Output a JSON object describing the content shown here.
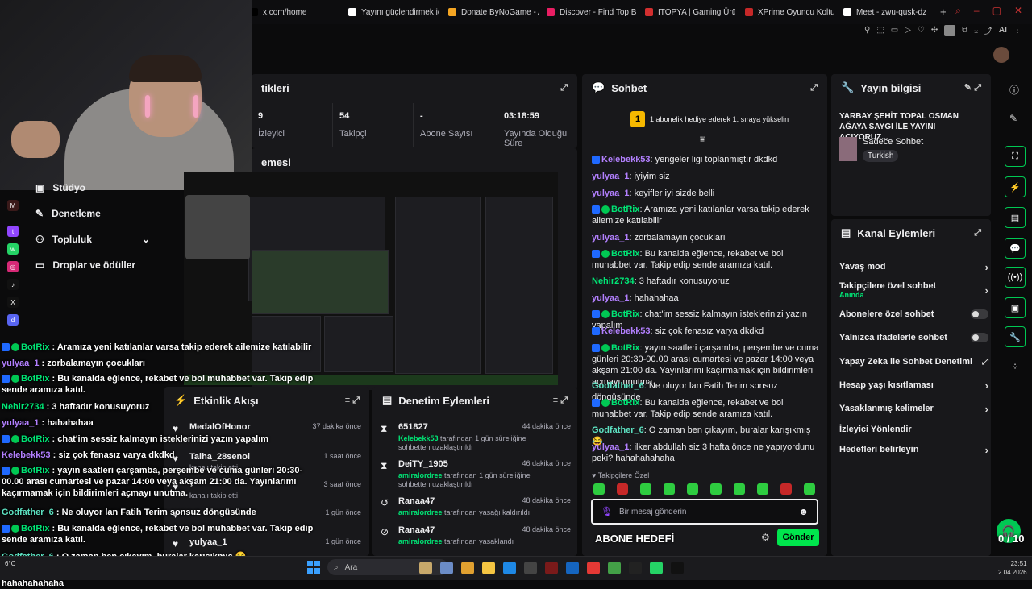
{
  "browser": {
    "tabs": [
      {
        "label": "x.com/home",
        "color": "#000000"
      },
      {
        "label": "Yayını güçlendirmek içi",
        "color": "#ffffff"
      },
      {
        "label": "Donate ByNoGame - Ak",
        "color": "#f5a623"
      },
      {
        "label": "Discover - Find Top Blo",
        "color": "#e91e63"
      },
      {
        "label": "ITOPYA | Gaming Ürünle",
        "color": "#d32f2f"
      },
      {
        "label": "XPrime Oyuncu Koltuğu",
        "color": "#c62828"
      },
      {
        "label": "Meet - zwu-qusk-dz",
        "color": "#ffffff"
      }
    ],
    "new_tab": "+",
    "toolbar_ai": "AI"
  },
  "nav": {
    "items": [
      {
        "label": "Stüdyo"
      },
      {
        "label": "Denetleme"
      },
      {
        "label": "Topluluk"
      },
      {
        "label": "Droplar ve ödüller"
      }
    ]
  },
  "stats": {
    "title": "tikleri",
    "items": [
      {
        "value": "9",
        "label": "İzleyici"
      },
      {
        "value": "54",
        "label": "Takipçi"
      },
      {
        "value": "-",
        "label": "Abone Sayısı"
      },
      {
        "value": "03:18:59",
        "label": "Yayında Olduğu Süre"
      }
    ]
  },
  "preview": {
    "title": "emesi"
  },
  "chat": {
    "title": "Sohbet",
    "banner": "1 abonelik hediye ederek 1. sıraya yükselin",
    "banner_rank": "1",
    "messages": [
      {
        "user": "Kelebekk53",
        "text": ": yengeler ligi toplanmıştır dkdkd",
        "color": "#b380ff",
        "badge": "v"
      },
      {
        "user": "yulyaa_1",
        "text": ": iyiyim siz",
        "color": "#b380ff",
        "badge": ""
      },
      {
        "user": "yulyaa_1",
        "text": ": keyifler iyi sizde belli",
        "color": "#b380ff",
        "badge": ""
      },
      {
        "user": "BotRix",
        "text": ": Aramıza yeni katılanlar varsa takip ederek ailemize katılabilir",
        "color": "#00e676",
        "badge": "vg"
      },
      {
        "user": "yulyaa_1",
        "text": ": zorbalamayın çocukları",
        "color": "#b380ff",
        "badge": ""
      },
      {
        "user": "BotRix",
        "text": ": Bu kanalda eğlence, rekabet ve bol muhabbet var. Takip edip sende aramıza katıl.",
        "color": "#00e676",
        "badge": "vg"
      },
      {
        "user": "Nehir2734",
        "text": ": 3 haftadır konusuyoruz",
        "color": "#00e676",
        "badge": ""
      },
      {
        "user": "yulyaa_1",
        "text": ": hahahahaa",
        "color": "#b380ff",
        "badge": ""
      },
      {
        "user": "BotRix",
        "text": ": chat'im sessiz kalmayın isteklerinizi yazın yapalım",
        "color": "#00e676",
        "badge": "vg"
      },
      {
        "user": "Kelebekk53",
        "text": ": siz çok fenasız varya dkdkd",
        "color": "#b380ff",
        "badge": "v"
      },
      {
        "user": "BotRix",
        "text": ": yayın saatleri çarşamba, perşembe ve cuma günleri 20:30-00.00 arası cumartesi ve pazar 14:00 veya akşam 21:00 da. Yayınlarımı kaçırmamak için bildirimleri açmayı unutma.",
        "color": "#00e676",
        "badge": "vg"
      },
      {
        "user": "Godfather_6",
        "text": ": Ne oluyor lan Fatih Terim sonsuz döngüsünde",
        "color": "#5de2c2",
        "badge": ""
      },
      {
        "user": "BotRix",
        "text": ": Bu kanalda eğlence, rekabet ve bol muhabbet var. Takip edip sende aramıza katıl.",
        "color": "#00e676",
        "badge": "vg"
      },
      {
        "user": "Godfather_6",
        "text": ": O zaman ben çıkayım, buralar karışıkmış 😂",
        "color": "#5de2c2",
        "badge": ""
      },
      {
        "user": "yulyaa_1",
        "text": ": ilker abdullah siz 3 hafta önce ne yapıyordunu peki? hahahahahaha",
        "color": "#b380ff",
        "badge": ""
      }
    ],
    "followers_only": "Takipçilere Özel",
    "input_placeholder": "Bir mesaj gönderin",
    "send_label": "Gönder",
    "sub_label": "ABONE HEDEFİ"
  },
  "stream_info": {
    "title": "Yayın bilgisi",
    "stream_title": "YARBAY ŞEHİT TOPAL OSMAN AĞAYA SAYGI İLE YAYINI AÇIYORUZ...",
    "category": "Sadece Sohbet",
    "tag": "Turkish"
  },
  "channel_actions": {
    "title": "Kanal Eylemleri",
    "items": [
      {
        "label": "Yavaş mod",
        "kind": "chevron",
        "sub": ""
      },
      {
        "label": "Takipçilere özel sohbet",
        "kind": "chevron",
        "sub": "Anında"
      },
      {
        "label": "Abonelere özel sohbet",
        "kind": "toggle",
        "sub": ""
      },
      {
        "label": "Yalnızca ifadelerle sohbet",
        "kind": "toggle",
        "sub": ""
      },
      {
        "label": "Yapay Zeka ile Sohbet Denetimi",
        "kind": "external",
        "sub": ""
      },
      {
        "label": "Hesap yaşı kısıtlaması",
        "kind": "chevron",
        "sub": ""
      },
      {
        "label": "Yasaklanmış kelimeler",
        "kind": "chevron",
        "sub": ""
      },
      {
        "label": "İzleyici Yönlendir",
        "kind": "none",
        "sub": ""
      },
      {
        "label": "Hedefleri belirleyin",
        "kind": "chevron",
        "sub": ""
      }
    ]
  },
  "activity": {
    "title": "Etkinlik Akışı",
    "items": [
      {
        "name": "MedalOfHonor",
        "time": "37 dakika önce",
        "sub": ""
      },
      {
        "name": "Talha_28senol",
        "time": "1 saat önce",
        "sub": "kanalı takip etti"
      },
      {
        "name": "",
        "time": "3 saat önce",
        "sub": "kanalı takip etti"
      },
      {
        "name": "",
        "time": "1 gün önce",
        "sub": ""
      },
      {
        "name": "yulyaa_1",
        "time": "1 gün önce",
        "sub": ""
      }
    ]
  },
  "moderation": {
    "title": "Denetim Eylemleri",
    "items": [
      {
        "name": "651827",
        "actor": "Kelebekk53",
        "desc": " tarafından 1 gün süreliğine sohbetten uzaklaştırıldı",
        "time": "44 dakika önce"
      },
      {
        "name": "DeiTY_1905",
        "actor": "amiralordree",
        "desc": " tarafından 1 gün süreliğine sohbetten uzaklaştırıldı",
        "time": "46 dakika önce"
      },
      {
        "name": "Ranaa47",
        "actor": "amiralordree",
        "desc": " tarafından yasağı kaldırıldı",
        "time": "48 dakika önce"
      },
      {
        "name": "Ranaa47",
        "actor": "amiralordree",
        "desc": " tarafından yasaklandı",
        "time": "48 dakika önce"
      }
    ]
  },
  "overlay_chat": [
    {
      "user": "BotRix",
      "text": " : Aramıza yeni katılanlar varsa takip ederek ailemize katılabilir",
      "color": "#00e676"
    },
    {
      "user": "yulyaa_1",
      "text": " : zorbalamayın çocukları",
      "color": "#b380ff"
    },
    {
      "user": "BotRix",
      "text": " : Bu kanalda eğlence, rekabet ve bol muhabbet var. Takip edip sende aramıza katıl.",
      "color": "#00e676"
    },
    {
      "user": "Nehir2734",
      "text": " : 3 haftadır konusuyoruz",
      "color": "#00e676"
    },
    {
      "user": "yulyaa_1",
      "text": " : hahahahaa",
      "color": "#b380ff"
    },
    {
      "user": "BotRix",
      "text": " : chat'im sessiz kalmayın isteklerinizi yazın yapalım",
      "color": "#00e676"
    },
    {
      "user": "Kelebekk53",
      "text": " : siz çok fenasız varya dkdkd",
      "color": "#b380ff"
    },
    {
      "user": "BotRix",
      "text": " : yayın saatleri çarşamba, perşembe ve cuma günleri 20:30-00.00 arası cumartesi ve pazar 14:00 veya akşam 21:00 da. Yayınlarımı kaçırmamak için bildirimleri açmayı unutma.",
      "color": "#00e676"
    },
    {
      "user": "Godfather_6",
      "text": " : Ne oluyor lan Fatih Terim sonsuz döngüsünde",
      "color": "#5de2c2"
    },
    {
      "user": "BotRix",
      "text": " : Bu kanalda eğlence, rekabet ve bol muhabbet var. Takip edip sende aramıza katıl.",
      "color": "#00e676"
    },
    {
      "user": "Godfather_6",
      "text": " : O zaman ben çıkayım, buralar karışıkmış 😂",
      "color": "#5de2c2"
    },
    {
      "user": "yulyaa_1",
      "text": " : ilker abdullah siz 3 hafta önce ne yapıyordunu peki? hahahahahaha",
      "color": "#b380ff"
    }
  ],
  "goal_overlay": {
    "label": "ABONE HEDEFİ",
    "count": "0 / 10"
  },
  "taskbar": {
    "search_placeholder": "Ara",
    "time": "23:51",
    "date": "2.04.2026",
    "weather": "6°C"
  }
}
